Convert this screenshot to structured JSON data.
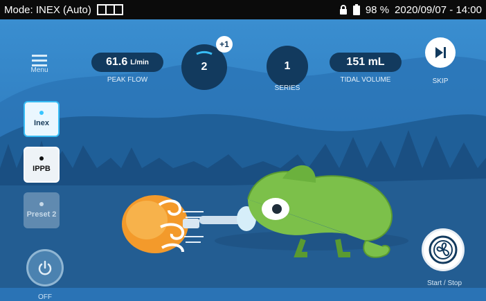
{
  "status": {
    "mode": "Mode: INEX (Auto)",
    "battery": "98 %",
    "datetime": "2020/09/07 - 14:00"
  },
  "menu": {
    "label": "Menu"
  },
  "modes": [
    {
      "label": "Inex"
    },
    {
      "label": "IPPB"
    },
    {
      "label": "Preset 2"
    }
  ],
  "power": {
    "label": "OFF"
  },
  "metrics": {
    "peak_flow": {
      "value": "61.6",
      "unit": "L/min",
      "label": "PEAK FLOW"
    },
    "counter": {
      "value": "2",
      "badge": "+1"
    },
    "series": {
      "value": "1",
      "label": "SERIES"
    },
    "tidal_volume": {
      "value": "151 mL",
      "label": "TIDAL VOLUME"
    }
  },
  "skip": {
    "label": "SKIP"
  },
  "start_stop": {
    "label": "Start / Stop"
  },
  "colors": {
    "sky": "#2f80c4",
    "mountains": "#1f5f98",
    "forest": "#1a4f82",
    "ground": "#235d92",
    "pill": "#123a5e",
    "accent": "#39bdf5",
    "chameleon": "#7cc04a",
    "fan_orange": "#f39a2b"
  },
  "icons": {
    "menu": "hamburger-menu-icon",
    "power": "power-icon",
    "skip": "skip-next-icon",
    "start_stop": "fan-circle-icon",
    "lock": "lock-icon",
    "battery": "battery-icon"
  }
}
